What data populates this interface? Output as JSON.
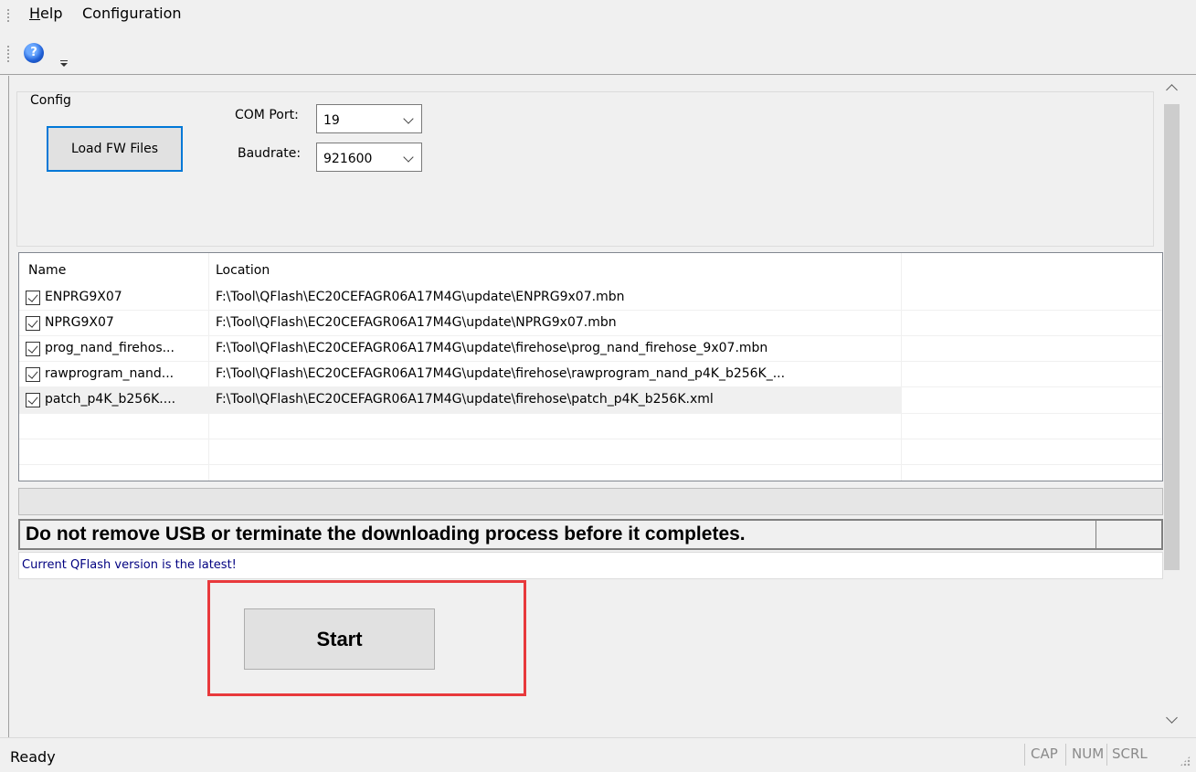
{
  "menu": {
    "items": [
      {
        "label": "Help"
      },
      {
        "label": "Configuration"
      }
    ]
  },
  "toolbar": {
    "help_icon": "help-globe-icon",
    "help_glyph": "?",
    "overflow_icon": "chevron-down-icon"
  },
  "config": {
    "group_label": "Config",
    "load_button": "Load FW Files",
    "com_port_label": "COM Port:",
    "com_port_value": "19",
    "baudrate_label": "Baudrate:",
    "baudrate_value": "921600"
  },
  "file_list": {
    "columns": [
      "Name",
      "Location"
    ],
    "rows": [
      {
        "checked": true,
        "name": "ENPRG9X07",
        "location": "F:\\Tool\\QFlash\\EC20CEFAGR06A17M4G\\update\\ENPRG9x07.mbn"
      },
      {
        "checked": true,
        "name": "NPRG9X07",
        "location": "F:\\Tool\\QFlash\\EC20CEFAGR06A17M4G\\update\\NPRG9x07.mbn"
      },
      {
        "checked": true,
        "name": "prog_nand_firehos...",
        "location": "F:\\Tool\\QFlash\\EC20CEFAGR06A17M4G\\update\\firehose\\prog_nand_firehose_9x07.mbn"
      },
      {
        "checked": true,
        "name": "rawprogram_nand...",
        "location": "F:\\Tool\\QFlash\\EC20CEFAGR06A17M4G\\update\\firehose\\rawprogram_nand_p4K_b256K_..."
      },
      {
        "checked": true,
        "name": "patch_p4K_b256K....",
        "location": "F:\\Tool\\QFlash\\EC20CEFAGR06A17M4G\\update\\firehose\\patch_p4K_b256K.xml"
      }
    ]
  },
  "progress": {
    "value": 0
  },
  "warning_text": "Do not remove USB or terminate the downloading process before it completes.",
  "version_text": "Current QFlash version is the latest!",
  "start_button": "Start",
  "highlight_color": "#e8393c",
  "statusbar": {
    "status": "Ready",
    "indicators": [
      "CAP",
      "NUM",
      "SCRL"
    ]
  }
}
